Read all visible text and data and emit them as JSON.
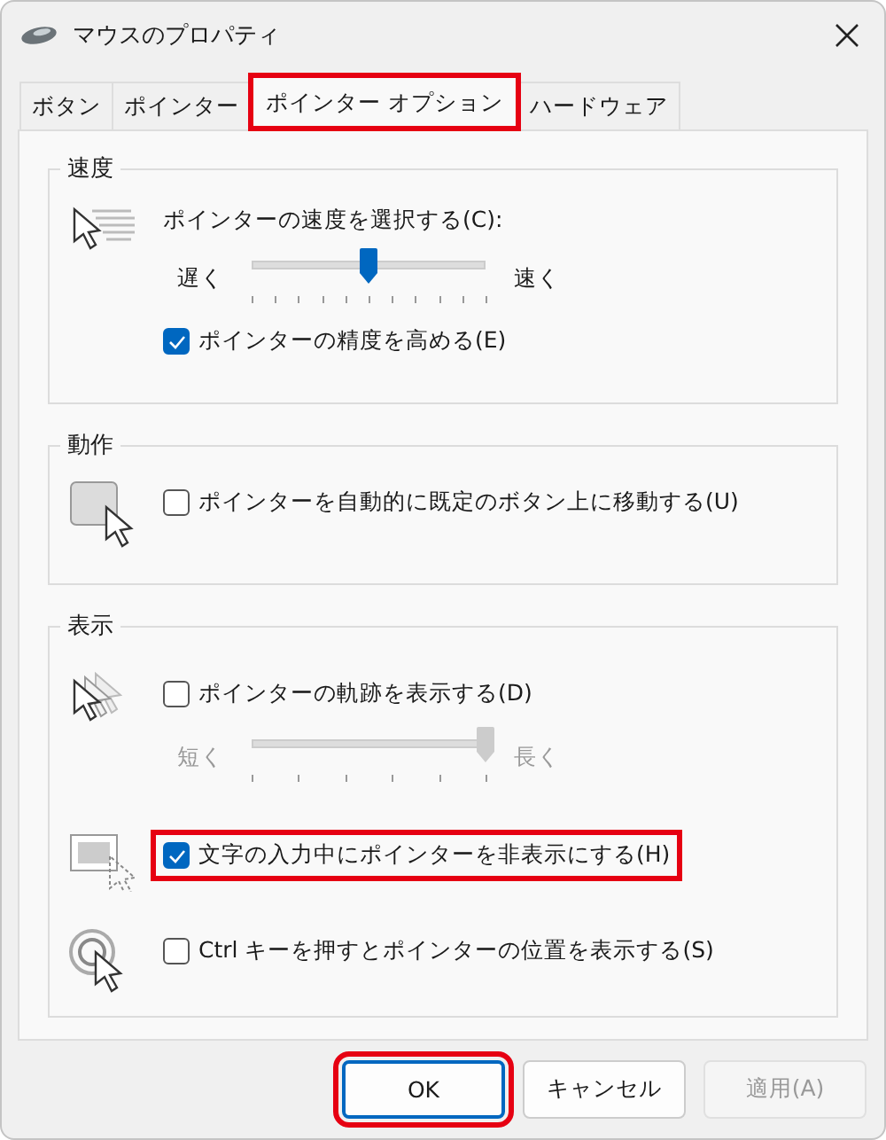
{
  "window": {
    "title": "マウスのプロパティ"
  },
  "tabs": [
    {
      "label": "ボタン",
      "selected": false,
      "highlighted": false
    },
    {
      "label": "ポインター",
      "selected": false,
      "highlighted": false
    },
    {
      "label": "ポインター オプション",
      "selected": true,
      "highlighted": true
    },
    {
      "label": "ハードウェア",
      "selected": false,
      "highlighted": false
    }
  ],
  "speed": {
    "title": "速度",
    "label": "ポインターの速度を選択する(C):",
    "slider": {
      "min_label": "遅く",
      "max_label": "速く",
      "level": 0.5,
      "disabled": false
    },
    "option": {
      "label": "ポインターの精度を高める(E)",
      "checked": true,
      "highlighted": false
    }
  },
  "motion": {
    "title": "動作",
    "option": {
      "label": "ポインターを自動的に既定のボタン上に移動する(U)",
      "checked": false,
      "highlighted": false
    }
  },
  "visibility": {
    "title": "表示",
    "trails": {
      "label": "ポインターの軌跡を表示する(D)",
      "checked": false,
      "highlighted": false
    },
    "trail_slider": {
      "min_label": "短く",
      "max_label": "長く",
      "level": 1,
      "disabled": true
    },
    "hide": {
      "label": "文字の入力中にポインターを非表示にする(H)",
      "checked": true,
      "highlighted": true
    },
    "ctrl": {
      "label": "Ctrl キーを押すとポインターの位置を表示する(S)",
      "checked": false,
      "highlighted": false
    }
  },
  "buttons": [
    {
      "label": "OK",
      "default": true,
      "disabled": false,
      "highlighted": true
    },
    {
      "label": "キャンセル",
      "default": false,
      "disabled": false,
      "highlighted": false
    },
    {
      "label": "適用(A)",
      "default": false,
      "disabled": true,
      "highlighted": false
    }
  ]
}
